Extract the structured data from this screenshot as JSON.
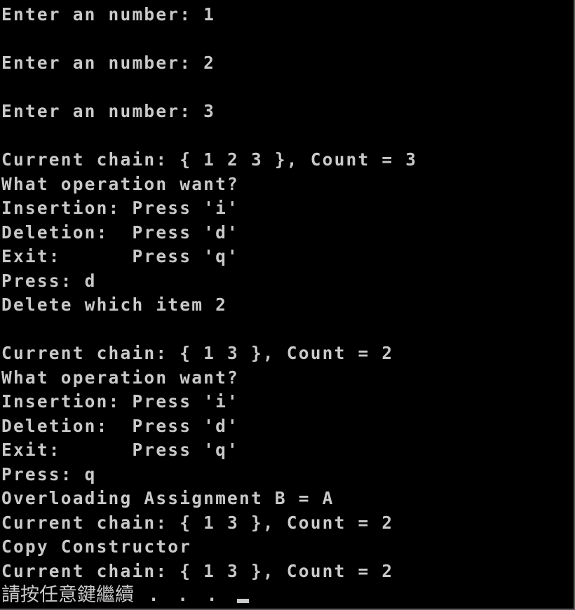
{
  "console": {
    "lines": [
      "Enter an number: 1",
      "",
      "Enter an number: 2",
      "",
      "Enter an number: 3",
      "",
      "Current chain: { 1 2 3 }, Count = 3",
      "What operation want?",
      "Insertion: Press 'i'",
      "Deletion:  Press 'd'",
      "Exit:      Press 'q'",
      "Press: d",
      "Delete which item 2",
      "",
      "Current chain: { 1 3 }, Count = 2",
      "What operation want?",
      "Insertion: Press 'i'",
      "Deletion:  Press 'd'",
      "Exit:      Press 'q'",
      "Press: q",
      "Overloading Assignment B = A",
      "Current chain: { 1 3 }, Count = 2",
      "Copy Constructor",
      "Current chain: { 1 3 }, Count = 2"
    ],
    "prompt": "請按任意鍵繼續",
    "prompt_dots": " . . . "
  }
}
